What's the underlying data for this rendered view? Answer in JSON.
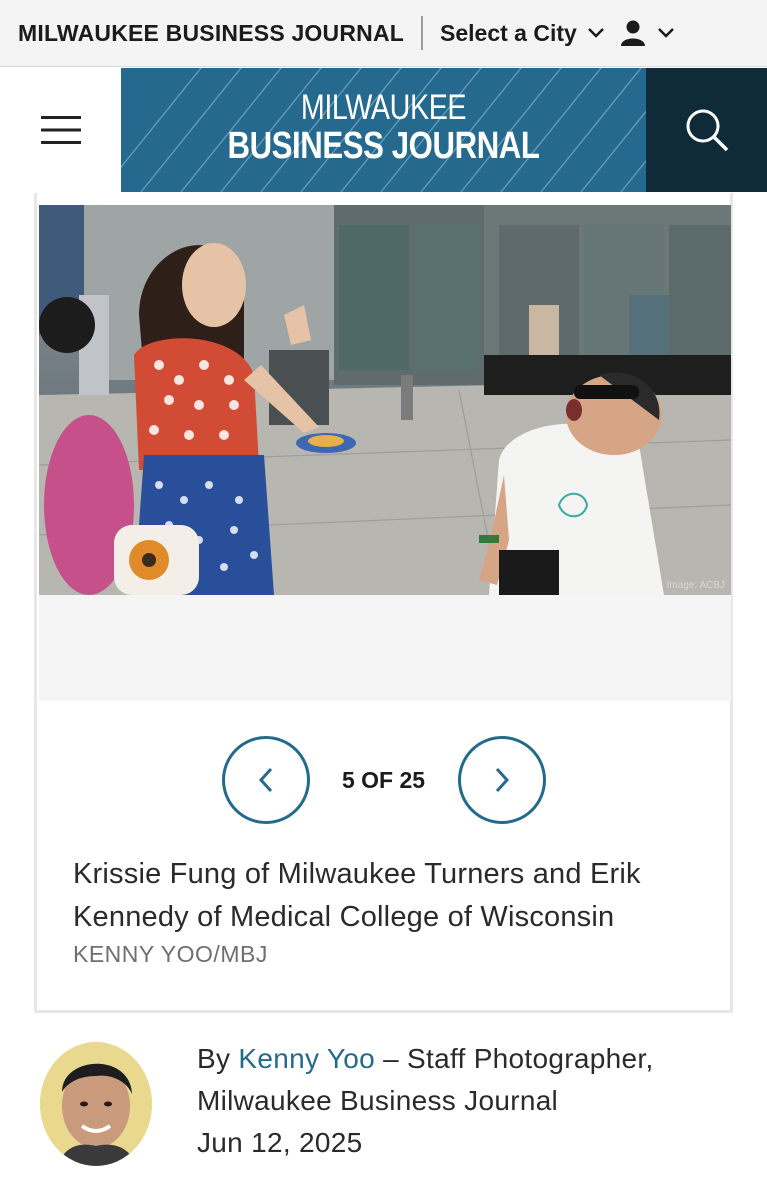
{
  "topbar": {
    "publication": "MILWAUKEE BUSINESS JOURNAL",
    "city_select": "Select a City"
  },
  "masthead": {
    "logo_line1": "MILWAUKEE",
    "logo_line2": "BUSINESS JOURNAL"
  },
  "gallery": {
    "image_credit": "Image: ACBJ",
    "counter": "5 OF 25",
    "caption": "Krissie Fung of Milwaukee Turners and Erik Kennedy of Medical College of Wisconsin",
    "photo_credit": "KENNY YOO/MBJ"
  },
  "byline": {
    "by": "By",
    "author": "Kenny Yoo",
    "role": "– Staff Photographer, Milwaukee Business Journal",
    "date": "Jun 12, 2025"
  },
  "colors": {
    "brand_blue": "#256a8e",
    "dark_navy": "#0f2b3a",
    "accent": "#236a8c"
  },
  "icons": [
    "menu-icon",
    "search-icon",
    "chevron-down-icon",
    "user-icon",
    "chevron-left-icon",
    "chevron-right-icon"
  ]
}
